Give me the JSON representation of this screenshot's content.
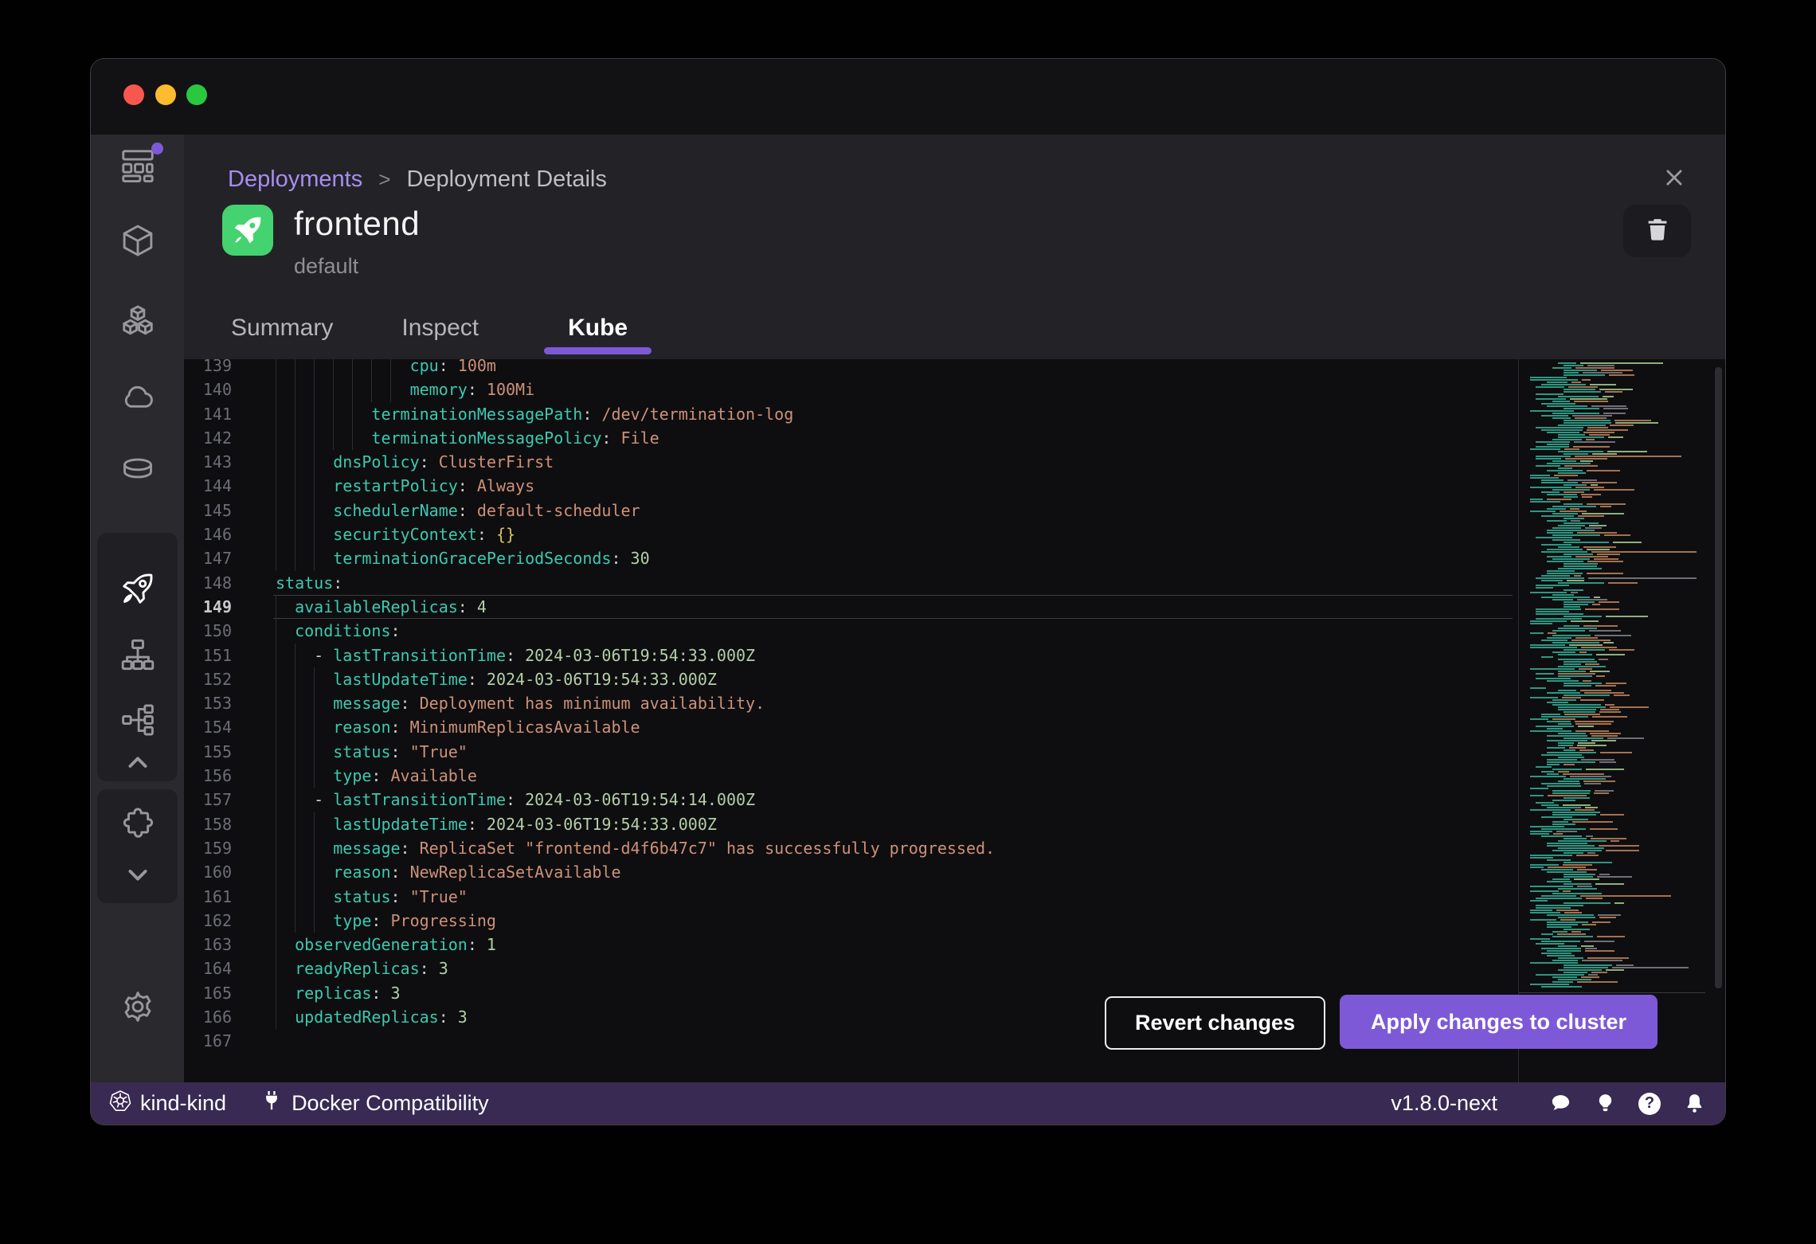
{
  "colors": {
    "accent": "#7d59d8",
    "breadcrumb_link": "#a78df0",
    "tile_green": "#44d370",
    "status_bg": "#382a52",
    "traffic_red": "#f9574e",
    "traffic_yellow": "#fcbc2e",
    "traffic_green": "#29c83f",
    "yaml_key": "#3dc9b0",
    "yaml_string": "#ce9178",
    "yaml_number": "#b5cea8",
    "yaml_brace": "#ddc258"
  },
  "breadcrumb": {
    "parent": "Deployments",
    "separator": ">",
    "current": "Deployment Details"
  },
  "header": {
    "title": "frontend",
    "namespace": "default"
  },
  "tabs": [
    {
      "id": "summary",
      "label": "Summary",
      "active": false
    },
    {
      "id": "inspect",
      "label": "Inspect",
      "active": false
    },
    {
      "id": "kube",
      "label": "Kube",
      "active": true
    }
  ],
  "sidebar": {
    "top_items": [
      {
        "icon": "dashboard",
        "badge": true,
        "active": false
      },
      {
        "icon": "containers",
        "active": false
      },
      {
        "icon": "pods",
        "active": false
      },
      {
        "icon": "images-cloud",
        "active": false
      },
      {
        "icon": "volumes",
        "active": false
      }
    ],
    "group1_items": [
      {
        "icon": "kubernetes-rocket",
        "active": true
      },
      {
        "icon": "services",
        "active": false
      },
      {
        "icon": "networks",
        "active": false
      }
    ],
    "group2_items": [
      {
        "icon": "extensions-puzzle",
        "active": false
      }
    ],
    "bottom_items": [
      {
        "icon": "settings-gear",
        "active": false
      }
    ]
  },
  "editor": {
    "active_line": 149,
    "lines": [
      {
        "n": 139,
        "indent": 14,
        "key": "cpu",
        "value": "100m",
        "vt": "str"
      },
      {
        "n": 140,
        "indent": 14,
        "key": "memory",
        "value": "100Mi",
        "vt": "str"
      },
      {
        "n": 141,
        "indent": 10,
        "key": "terminationMessagePath",
        "value": "/dev/termination-log",
        "vt": "str"
      },
      {
        "n": 142,
        "indent": 10,
        "key": "terminationMessagePolicy",
        "value": "File",
        "vt": "str"
      },
      {
        "n": 143,
        "indent": 6,
        "key": "dnsPolicy",
        "value": "ClusterFirst",
        "vt": "str"
      },
      {
        "n": 144,
        "indent": 6,
        "key": "restartPolicy",
        "value": "Always",
        "vt": "str"
      },
      {
        "n": 145,
        "indent": 6,
        "key": "schedulerName",
        "value": "default-scheduler",
        "vt": "str"
      },
      {
        "n": 146,
        "indent": 6,
        "key": "securityContext",
        "value": "{}",
        "vt": "obj"
      },
      {
        "n": 147,
        "indent": 6,
        "key": "terminationGracePeriodSeconds",
        "value": "30",
        "vt": "num"
      },
      {
        "n": 148,
        "indent": 0,
        "key": "status",
        "value": "",
        "vt": ""
      },
      {
        "n": 149,
        "indent": 2,
        "key": "availableReplicas",
        "value": "4",
        "vt": "num"
      },
      {
        "n": 150,
        "indent": 2,
        "key": "conditions",
        "value": "",
        "vt": ""
      },
      {
        "n": 151,
        "indent": 4,
        "dash": true,
        "key": "lastTransitionTime",
        "value": "2024-03-06T19:54:33.000Z",
        "vt": "num"
      },
      {
        "n": 152,
        "indent": 6,
        "key": "lastUpdateTime",
        "value": "2024-03-06T19:54:33.000Z",
        "vt": "num"
      },
      {
        "n": 153,
        "indent": 6,
        "key": "message",
        "value": "Deployment has minimum availability.",
        "vt": "str"
      },
      {
        "n": 154,
        "indent": 6,
        "key": "reason",
        "value": "MinimumReplicasAvailable",
        "vt": "str"
      },
      {
        "n": 155,
        "indent": 6,
        "key": "status",
        "value": "\"True\"",
        "vt": "str"
      },
      {
        "n": 156,
        "indent": 6,
        "key": "type",
        "value": "Available",
        "vt": "str"
      },
      {
        "n": 157,
        "indent": 4,
        "dash": true,
        "key": "lastTransitionTime",
        "value": "2024-03-06T19:54:14.000Z",
        "vt": "num"
      },
      {
        "n": 158,
        "indent": 6,
        "key": "lastUpdateTime",
        "value": "2024-03-06T19:54:33.000Z",
        "vt": "num"
      },
      {
        "n": 159,
        "indent": 6,
        "key": "message",
        "value": "ReplicaSet \"frontend-d4f6b47c7\" has successfully progressed.",
        "vt": "str"
      },
      {
        "n": 160,
        "indent": 6,
        "key": "reason",
        "value": "NewReplicaSetAvailable",
        "vt": "str"
      },
      {
        "n": 161,
        "indent": 6,
        "key": "status",
        "value": "\"True\"",
        "vt": "str"
      },
      {
        "n": 162,
        "indent": 6,
        "key": "type",
        "value": "Progressing",
        "vt": "str"
      },
      {
        "n": 163,
        "indent": 2,
        "key": "observedGeneration",
        "value": "1",
        "vt": "num"
      },
      {
        "n": 164,
        "indent": 2,
        "key": "readyReplicas",
        "value": "3",
        "vt": "num"
      },
      {
        "n": 165,
        "indent": 2,
        "key": "replicas",
        "value": "3",
        "vt": "num"
      },
      {
        "n": 166,
        "indent": 2,
        "key": "updatedReplicas",
        "value": "3",
        "vt": "num"
      },
      {
        "n": 167,
        "blank": true
      }
    ]
  },
  "actions": {
    "revert_label": "Revert changes",
    "apply_label": "Apply changes to cluster"
  },
  "statusbar": {
    "cluster": "kind-kind",
    "compatibility": "Docker Compatibility",
    "version": "v1.8.0-next"
  }
}
